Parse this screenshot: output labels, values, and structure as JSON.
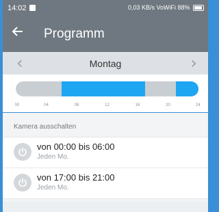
{
  "statusbar": {
    "time": "14:02",
    "right_text": "0,03 KB/s  VoWiFi  88%"
  },
  "appbar": {
    "back_icon": "arrow-left-icon",
    "title": "Programm"
  },
  "daybar": {
    "prev_icon": "chevron-left-icon",
    "prev_glyph": "‹",
    "day": "Montag",
    "next_icon": "chevron-right-icon",
    "next_glyph": "›"
  },
  "timeline": {
    "active_color": "#1fa6f2",
    "inactive_color": "#c9ced2",
    "hour_start": 0,
    "hour_end": 24,
    "active_ranges": [
      {
        "from": 6,
        "to": 17
      },
      {
        "from": 21,
        "to": 24
      }
    ],
    "ticks": [
      "00",
      "04",
      "08",
      "12",
      "16",
      "20",
      "24"
    ]
  },
  "section": {
    "label": "Kamera ausschalten"
  },
  "schedules": [
    {
      "title": "von 00:00 bis 06:00",
      "subtitle": "Jeden Mo.",
      "icon": "power-icon"
    },
    {
      "title": "von 17:00 bis 21:00",
      "subtitle": "Jeden Mo.",
      "icon": "power-icon"
    }
  ]
}
